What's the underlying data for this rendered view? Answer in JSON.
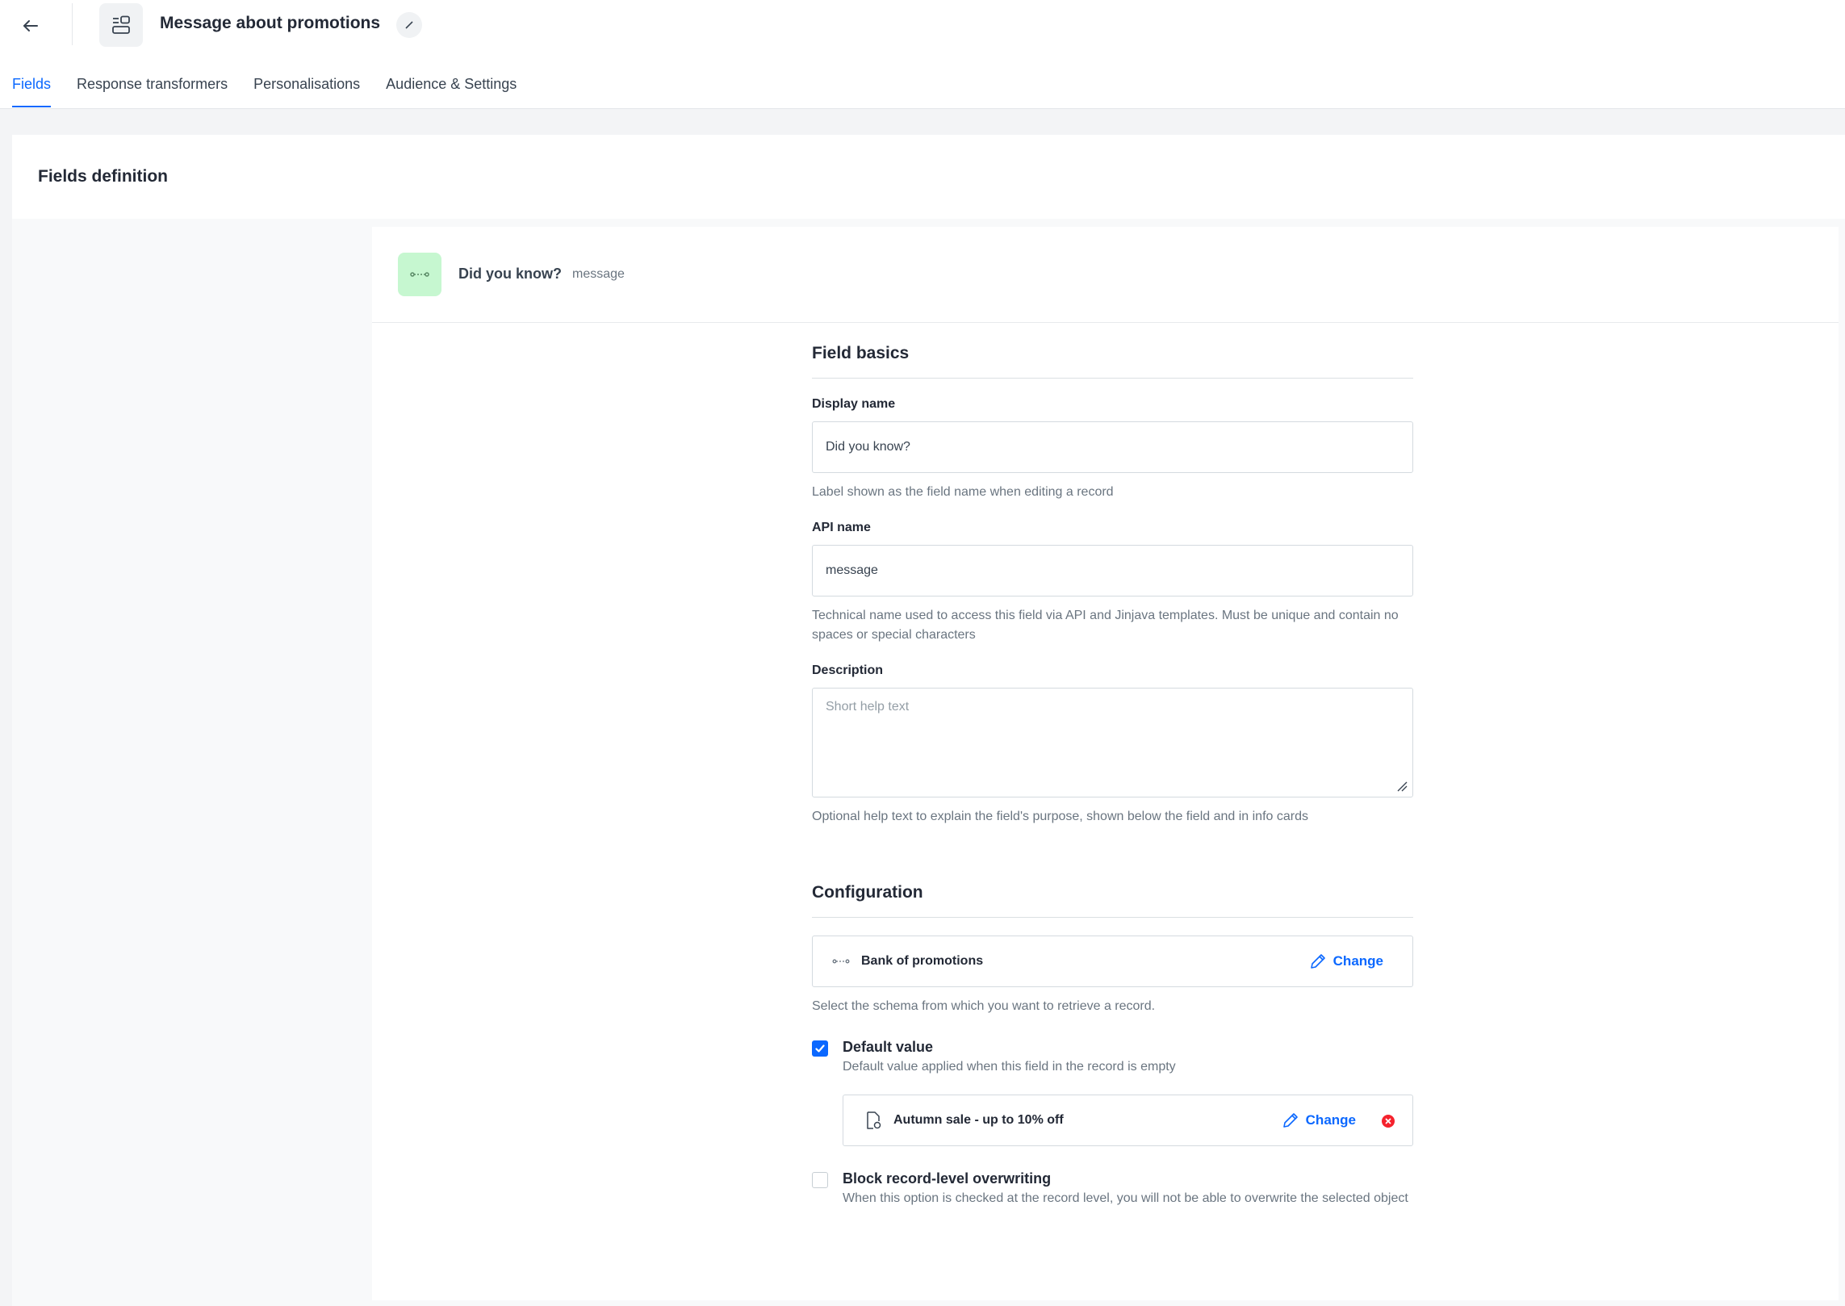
{
  "header": {
    "title": "Message about promotions"
  },
  "tabs": [
    {
      "label": "Fields"
    },
    {
      "label": "Response transformers"
    },
    {
      "label": "Personalisations"
    },
    {
      "label": "Audience & Settings"
    }
  ],
  "page": {
    "heading": "Fields definition"
  },
  "field": {
    "display_name": "Did you know?",
    "api_name": "message"
  },
  "basics": {
    "title": "Field basics",
    "display_name_label": "Display name",
    "display_name_value": "Did you know?",
    "display_name_help": "Label shown as the field name when editing a record",
    "api_name_label": "API name",
    "api_name_value": "message",
    "api_name_help": "Technical name used to access this field via API and Jinjava templates. Must be unique and contain no spaces or special characters",
    "description_label": "Description",
    "description_placeholder": "Short help text",
    "description_help": "Optional help text to explain the field's purpose, shown below the field and in info cards"
  },
  "configuration": {
    "title": "Configuration",
    "schema_name": "Bank of promotions",
    "change_label": "Change",
    "schema_help": "Select the schema from which you want to retrieve a record.",
    "default_value_title": "Default value",
    "default_value_desc": "Default value applied when this field in the record is empty",
    "default_record": "Autumn sale - up to 10% off",
    "default_change_label": "Change",
    "block_title": "Block record-level overwriting",
    "block_desc": "When this option is checked at the record level, you will not be able to overwrite the selected object"
  },
  "colors": {
    "accent": "#0b68ff",
    "field_icon_bg": "#c6f7d0",
    "danger": "#f5222d"
  }
}
